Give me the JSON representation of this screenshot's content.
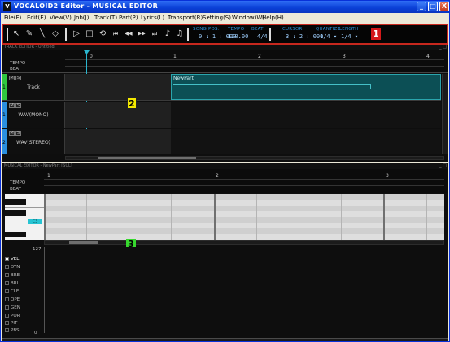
{
  "window": {
    "title": "VOCALOID2 Editor - MUSICAL EDITOR",
    "app_icon": "V",
    "buttons": {
      "minimize": "_",
      "maximize": "□",
      "close": "X"
    }
  },
  "menu": [
    "File(F)",
    "Edit(E)",
    "View(V)",
    "Job(J)",
    "Track(T)",
    "Part(P)",
    "Lyrics(L)",
    "Transport(R)",
    "Setting(S)",
    "Window(W)",
    "Help(H)"
  ],
  "toolbar": {
    "song_pos_label": "SONG POS.",
    "song_pos_value": "0 : 1 : 000",
    "tempo_label": "TEMPO",
    "tempo_value": "120.00",
    "beat_label": "BEAT",
    "beat_value": "4/4",
    "cursor_label": "CURSOR",
    "cursor_value": "3 : 2 : 000",
    "quantize_label": "QUANTIZE",
    "quantize_value": "1/4 ▾",
    "length_label": "LENGTH",
    "length_value": "1/4 ▾",
    "tools": {
      "arrow": "↖",
      "pencil": "✎",
      "line": "╲",
      "eraser": "◇",
      "play": "▷",
      "stop": "□",
      "loop": "⟲",
      "rewind_start": "⏮",
      "rewind": "◀◀",
      "forward": "▶▶",
      "forward_end": "⏭",
      "scroll": "♪",
      "auto": "♫"
    }
  },
  "markers": {
    "one": "1",
    "two": "2",
    "three": "3"
  },
  "track_editor": {
    "header": "TRACK EDITOR - Untitled",
    "tempo_label": "TEMPO",
    "beat_label": "BEAT",
    "measures": [
      "0",
      "1",
      "2",
      "3",
      "4"
    ],
    "tracks": [
      {
        "num": "1",
        "name": "Track",
        "color": "#2fc63f"
      },
      {
        "num": "1",
        "name": "WAV(MONO)",
        "color": "#2b8fe0"
      },
      {
        "num": "2",
        "name": "WAV(STEREO)",
        "color": "#2b8fe0"
      }
    ],
    "part_name": "NewPart",
    "ms_labels": [
      "M",
      "S"
    ]
  },
  "musical_editor": {
    "header": "MUSICAL EDITOR - NewPart [SUL]",
    "tempo_label": "TEMPO",
    "beat_label": "BEAT",
    "measures": [
      "1",
      "2",
      "3"
    ],
    "c_key": "C3"
  },
  "control_editor": {
    "max_value": "127",
    "min_value": "0",
    "items": [
      "VEL",
      "DYN",
      "BRE",
      "BRI",
      "CLE",
      "OPE",
      "GEN",
      "POR",
      "PIT",
      "PBS"
    ]
  }
}
